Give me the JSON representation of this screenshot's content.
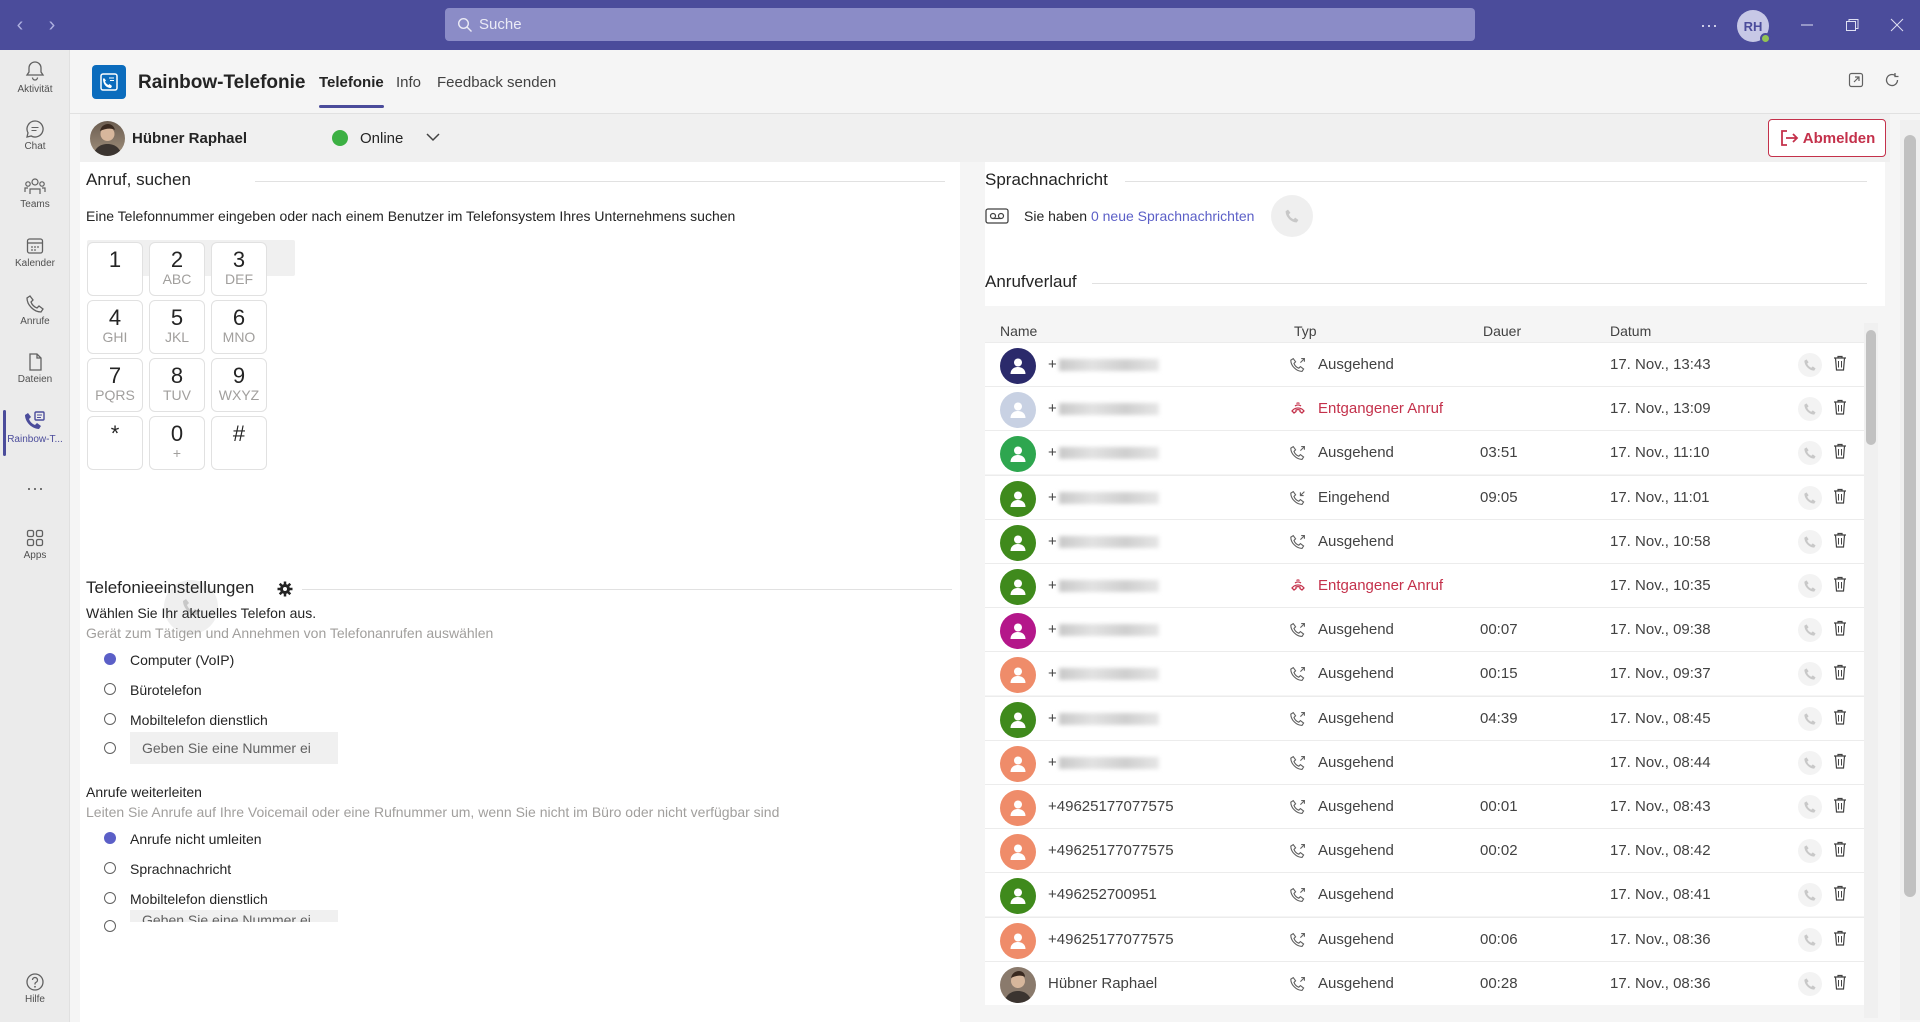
{
  "topbar": {
    "search_placeholder": "Suche",
    "avatar_initials": "RH",
    "more_label": "···"
  },
  "rail": [
    {
      "label": "Aktivität",
      "icon": "bell-icon"
    },
    {
      "label": "Chat",
      "icon": "chat-icon"
    },
    {
      "label": "Teams",
      "icon": "teams-icon"
    },
    {
      "label": "Kalender",
      "icon": "calendar-icon"
    },
    {
      "label": "Anrufe",
      "icon": "phone-icon"
    },
    {
      "label": "Dateien",
      "icon": "file-icon"
    },
    {
      "label": "Rainbow-T...",
      "icon": "rainbow-phone-icon"
    },
    {
      "label": "···",
      "icon": "more-icon"
    },
    {
      "label": "Apps",
      "icon": "apps-icon"
    },
    {
      "label": "Hilfe",
      "icon": "help-icon"
    }
  ],
  "app": {
    "title": "Rainbow-Telefonie",
    "tabs": [
      "Telefonie",
      "Info",
      "Feedback senden"
    ]
  },
  "user": {
    "name": "Hübner Raphael",
    "status": "Online",
    "logout": "Abmelden"
  },
  "dial": {
    "title": "Anruf, suchen",
    "desc": "Eine Telefonnummer eingeben oder nach einem Benutzer im Telefonsystem Ihres Unternehmens suchen",
    "keys": [
      {
        "d": "1",
        "l": ""
      },
      {
        "d": "2",
        "l": "ABC"
      },
      {
        "d": "3",
        "l": "DEF"
      },
      {
        "d": "4",
        "l": "GHI"
      },
      {
        "d": "5",
        "l": "JKL"
      },
      {
        "d": "6",
        "l": "MNO"
      },
      {
        "d": "7",
        "l": "PQRS"
      },
      {
        "d": "8",
        "l": "TUV"
      },
      {
        "d": "9",
        "l": "WXYZ"
      },
      {
        "d": "*",
        "l": ""
      },
      {
        "d": "0",
        "l": "+"
      },
      {
        "d": "#",
        "l": ""
      }
    ]
  },
  "settings": {
    "title": "Telefonieeinstellungen",
    "phone_title": "Wählen Sie Ihr aktuelles Telefon aus.",
    "phone_desc": "Gerät zum Tätigen und Annehmen von Telefonanrufen auswählen",
    "phone_options": [
      "Computer (VoIP)",
      "Bürotelefon",
      "Mobiltelefon dienstlich"
    ],
    "number_placeholder": "Geben Sie eine Nummer ei",
    "forward_title": "Anrufe weiterleiten",
    "forward_desc": "Leiten Sie Anrufe auf Ihre Voicemail oder eine Rufnummer um, wenn Sie nicht im Büro oder nicht verfügbar sind",
    "forward_options": [
      "Anrufe nicht umleiten",
      "Sprachnachricht",
      "Mobiltelefon dienstlich"
    ],
    "forward_placeholder": "Geben Sie eine Nummer ei"
  },
  "voicemail": {
    "title": "Sprachnachricht",
    "prefix": "Sie haben",
    "link": "0 neue Sprachnachrichten"
  },
  "history": {
    "title": "Anrufverlauf",
    "columns": [
      "Name",
      "Typ",
      "Dauer",
      "Datum"
    ],
    "rows": [
      {
        "name": "+",
        "blur": true,
        "type": "Ausgehend",
        "missed": false,
        "dur": "",
        "date": "17. Nov., 13:43",
        "color": "#2b2a6b",
        "dir": "out"
      },
      {
        "name": "+",
        "blur": true,
        "type": "Entgangener Anruf",
        "missed": true,
        "dur": "",
        "date": "17. Nov., 13:09",
        "color": "#c8d1e3",
        "dir": "missed"
      },
      {
        "name": "+",
        "blur": true,
        "type": "Ausgehend",
        "missed": false,
        "dur": "03:51",
        "date": "17. Nov., 11:10",
        "color": "#2ea64f",
        "dir": "out"
      },
      {
        "name": "+",
        "blur": true,
        "type": "Eingehend",
        "missed": false,
        "dur": "09:05",
        "date": "17. Nov., 11:01",
        "color": "#3f8a1c",
        "dir": "in"
      },
      {
        "name": "+",
        "blur": true,
        "type": "Ausgehend",
        "missed": false,
        "dur": "",
        "date": "17. Nov., 10:58",
        "color": "#3f8a1c",
        "dir": "out"
      },
      {
        "name": "+",
        "blur": true,
        "type": "Entgangener Anruf",
        "missed": true,
        "dur": "",
        "date": "17. Nov., 10:35",
        "color": "#3f8a1c",
        "dir": "missed"
      },
      {
        "name": "+",
        "blur": true,
        "type": "Ausgehend",
        "missed": false,
        "dur": "00:07",
        "date": "17. Nov., 09:38",
        "color": "#b4178a",
        "dir": "out"
      },
      {
        "name": "+",
        "blur": true,
        "type": "Ausgehend",
        "missed": false,
        "dur": "00:15",
        "date": "17. Nov., 09:37",
        "color": "#ef8c6a",
        "dir": "out"
      },
      {
        "name": "+",
        "blur": true,
        "type": "Ausgehend",
        "missed": false,
        "dur": "04:39",
        "date": "17. Nov., 08:45",
        "color": "#3f8a1c",
        "dir": "out"
      },
      {
        "name": "+",
        "blur": true,
        "type": "Ausgehend",
        "missed": false,
        "dur": "",
        "date": "17. Nov., 08:44",
        "color": "#ef8c6a",
        "dir": "out"
      },
      {
        "name": "+49625177077575",
        "blur": false,
        "type": "Ausgehend",
        "missed": false,
        "dur": "00:01",
        "date": "17. Nov., 08:43",
        "color": "#ef8c6a",
        "dir": "out"
      },
      {
        "name": "+49625177077575",
        "blur": false,
        "type": "Ausgehend",
        "missed": false,
        "dur": "00:02",
        "date": "17. Nov., 08:42",
        "color": "#ef8c6a",
        "dir": "out"
      },
      {
        "name": "+496252700951",
        "blur": false,
        "type": "Ausgehend",
        "missed": false,
        "dur": "",
        "date": "17. Nov., 08:41",
        "color": "#3f8a1c",
        "dir": "out"
      },
      {
        "name": "+49625177077575",
        "blur": false,
        "type": "Ausgehend",
        "missed": false,
        "dur": "00:06",
        "date": "17. Nov., 08:36",
        "color": "#ef8c6a",
        "dir": "out"
      },
      {
        "name": "Hübner Raphael",
        "blur": false,
        "type": "Ausgehend",
        "missed": false,
        "dur": "00:28",
        "date": "17. Nov., 08:36",
        "color": "photo",
        "dir": "out"
      }
    ]
  },
  "colors": {
    "brand": "#4b4c9b",
    "accent": "#5b5fc7",
    "danger": "#c4314b",
    "online": "#3cb043"
  }
}
